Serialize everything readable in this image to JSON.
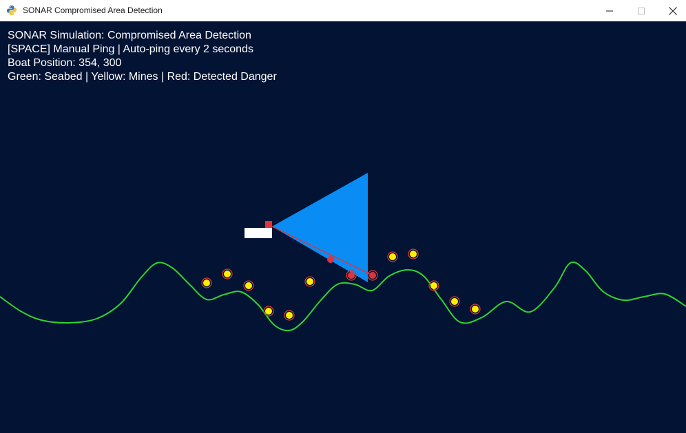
{
  "window": {
    "title": "SONAR Compromised Area Detection",
    "icon": "python-icon",
    "controls": {
      "minimize": "minimize-icon",
      "maximize": "maximize-icon",
      "close": "close-icon"
    }
  },
  "hud": {
    "line1": "SONAR Simulation: Compromised Area Detection",
    "line2": "[SPACE] Manual Ping | Auto-ping every 2 seconds",
    "line3": "Boat Position: 354, 300",
    "line4": "Green: Seabed | Yellow: Mines | Red: Detected Danger"
  },
  "colors": {
    "background": "#031333",
    "seabed": "#2fd62f",
    "mine_fill": "#ffee00",
    "mine_ring": "#d23a3a",
    "detected": "#e0333a",
    "sonar_beam": "#0a8cf5",
    "boat": "#ffffff",
    "boat_marker": "#e0333a"
  }
}
